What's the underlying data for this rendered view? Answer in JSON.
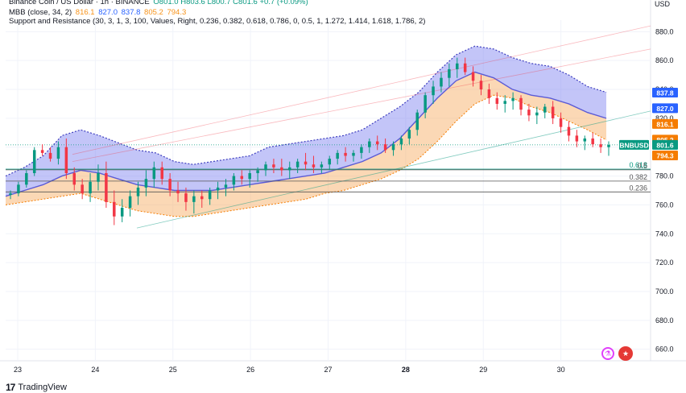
{
  "header": {
    "title_line": "Binance Coin / US Dollar · 1h · BINANCE",
    "ohlc": "O801.0 H803.6 L800.7 C801.6 +0.7 (+0.09%)",
    "mbb_label": "MBB (close, 34, 2)",
    "mbb_values": [
      "816.1",
      "827.0",
      "837.8",
      "805.2",
      "794.3"
    ],
    "sr_label": "Support and Resistance (30, 3, 1, 3, 100, Values, Right, 0.236, 0.382, 0.618, 0.786, 0, 0.5, 1, 1.272, 1.414, 1.618, 1.786, 2)",
    "currency": "USD"
  },
  "branding": {
    "logo_mark": "17",
    "logo_text": "TradingView"
  },
  "icons": {
    "flask": "flask-icon",
    "flag": "us-flag-icon"
  },
  "colors": {
    "up": "#089981",
    "down": "#f23645",
    "upper_band_fill": "#7b7ef0",
    "lower_band_fill": "#f7a85a",
    "basis": "#5b5bd6",
    "fib_line": "#555555",
    "support_green": "#089981"
  },
  "chart_data": {
    "type": "candlestick",
    "symbol": "BNBUSD",
    "x_ticks": [
      "23",
      "24",
      "25",
      "26",
      "27",
      "28",
      "29",
      "30"
    ],
    "y_ticks": [
      660.0,
      680.0,
      700.0,
      720.0,
      740.0,
      760.0,
      780.0,
      800.0,
      820.0,
      840.0,
      860.0,
      880.0
    ],
    "ylim": [
      652,
      888
    ],
    "fib_levels": [
      {
        "label": "0.618",
        "value": 784.8
      },
      {
        "label": "0.5",
        "value": 784.3
      },
      {
        "label": "0.382",
        "value": 776.5
      },
      {
        "label": "0.236",
        "value": 769.0
      }
    ],
    "price_tags": [
      {
        "label": "837.8",
        "value": 837.8,
        "color": "#2962ff"
      },
      {
        "label": "827.0",
        "value": 827.0,
        "color": "#2962ff"
      },
      {
        "label": "816.1",
        "value": 816.1,
        "color": "#f57c00"
      },
      {
        "label": "805.2",
        "value": 805.2,
        "color": "#f57c00"
      },
      {
        "label": "BNBUSD",
        "value": 801.6,
        "color": "#089981"
      },
      {
        "label": "801.6",
        "value": 801.6,
        "color": "#089981"
      },
      {
        "label": "794.3",
        "value": 794.3,
        "color": "#f57c00"
      }
    ],
    "upper_band": [
      780,
      786,
      794,
      808,
      812,
      808,
      803,
      798,
      796,
      790,
      788,
      790,
      792,
      794,
      800,
      802,
      804,
      806,
      808,
      812,
      820,
      828,
      838,
      852,
      864,
      870,
      868,
      862,
      858,
      856,
      850,
      842,
      838
    ],
    "basis": [
      766,
      770,
      774,
      780,
      784,
      782,
      778,
      774,
      772,
      770,
      770,
      770,
      772,
      774,
      776,
      778,
      780,
      782,
      786,
      790,
      796,
      806,
      820,
      834,
      846,
      852,
      848,
      840,
      836,
      834,
      830,
      824,
      820
    ],
    "lower_band": [
      760,
      762,
      764,
      766,
      768,
      764,
      760,
      756,
      754,
      752,
      752,
      754,
      756,
      758,
      760,
      762,
      764,
      768,
      770,
      774,
      778,
      784,
      792,
      804,
      818,
      830,
      836,
      834,
      828,
      824,
      818,
      812,
      805
    ],
    "candles": [
      [
        767,
        770,
        764,
        768
      ],
      [
        768,
        776,
        766,
        774
      ],
      [
        774,
        784,
        772,
        782
      ],
      [
        782,
        800,
        780,
        798
      ],
      [
        798,
        802,
        794,
        796
      ],
      [
        796,
        800,
        790,
        792
      ],
      [
        792,
        804,
        788,
        800
      ],
      [
        800,
        806,
        778,
        782
      ],
      [
        782,
        786,
        770,
        774
      ],
      [
        774,
        778,
        764,
        768
      ],
      [
        768,
        782,
        762,
        776
      ],
      [
        776,
        788,
        770,
        782
      ],
      [
        782,
        790,
        758,
        762
      ],
      [
        762,
        770,
        746,
        752
      ],
      [
        752,
        764,
        748,
        758
      ],
      [
        758,
        770,
        752,
        766
      ],
      [
        766,
        776,
        760,
        772
      ],
      [
        772,
        784,
        766,
        778
      ],
      [
        778,
        790,
        772,
        786
      ],
      [
        786,
        790,
        774,
        778
      ],
      [
        778,
        782,
        766,
        770
      ],
      [
        770,
        776,
        762,
        768
      ],
      [
        768,
        772,
        756,
        762
      ],
      [
        762,
        770,
        754,
        766
      ],
      [
        766,
        770,
        758,
        764
      ],
      [
        764,
        772,
        760,
        770
      ],
      [
        770,
        776,
        764,
        772
      ],
      [
        772,
        778,
        766,
        774
      ],
      [
        774,
        782,
        770,
        780
      ],
      [
        780,
        784,
        774,
        778
      ],
      [
        778,
        784,
        772,
        782
      ],
      [
        782,
        786,
        776,
        784
      ],
      [
        784,
        790,
        780,
        788
      ],
      [
        788,
        792,
        782,
        786
      ],
      [
        786,
        792,
        780,
        784
      ],
      [
        784,
        790,
        778,
        786
      ],
      [
        786,
        792,
        782,
        790
      ],
      [
        790,
        796,
        784,
        788
      ],
      [
        788,
        794,
        782,
        786
      ],
      [
        786,
        790,
        782,
        788
      ],
      [
        788,
        794,
        784,
        792
      ],
      [
        792,
        798,
        788,
        796
      ],
      [
        796,
        800,
        790,
        794
      ],
      [
        794,
        798,
        790,
        796
      ],
      [
        796,
        802,
        792,
        800
      ],
      [
        800,
        806,
        796,
        804
      ],
      [
        804,
        808,
        798,
        802
      ],
      [
        802,
        806,
        796,
        798
      ],
      [
        798,
        804,
        794,
        802
      ],
      [
        802,
        808,
        798,
        806
      ],
      [
        806,
        814,
        802,
        812
      ],
      [
        812,
        826,
        808,
        824
      ],
      [
        824,
        838,
        820,
        836
      ],
      [
        836,
        846,
        830,
        842
      ],
      [
        842,
        852,
        838,
        848
      ],
      [
        848,
        858,
        842,
        854
      ],
      [
        854,
        862,
        848,
        858
      ],
      [
        858,
        862,
        850,
        852
      ],
      [
        852,
        856,
        842,
        846
      ],
      [
        846,
        850,
        836,
        840
      ],
      [
        840,
        844,
        830,
        834
      ],
      [
        834,
        838,
        826,
        830
      ],
      [
        830,
        836,
        824,
        832
      ],
      [
        832,
        838,
        826,
        834
      ],
      [
        834,
        836,
        822,
        826
      ],
      [
        826,
        830,
        818,
        822
      ],
      [
        822,
        828,
        816,
        824
      ],
      [
        824,
        830,
        820,
        828
      ],
      [
        828,
        832,
        816,
        820
      ],
      [
        820,
        824,
        810,
        814
      ],
      [
        814,
        818,
        804,
        808
      ],
      [
        808,
        812,
        800,
        804
      ],
      [
        804,
        808,
        798,
        806
      ],
      [
        806,
        810,
        800,
        802
      ],
      [
        802,
        806,
        796,
        800
      ],
      [
        800,
        804,
        794,
        801.6
      ]
    ]
  }
}
